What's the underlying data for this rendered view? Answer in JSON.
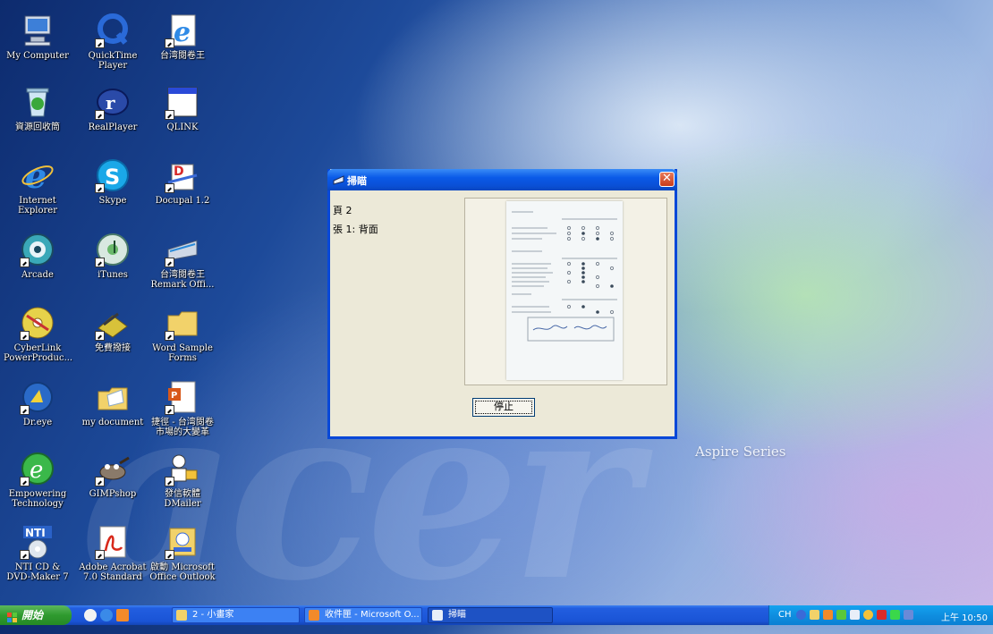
{
  "desktop": {
    "brand_text": "Aspire Series",
    "watermark_text": "acer",
    "icons": [
      {
        "id": "my-computer",
        "label": "My Computer",
        "icon": "computer-icon"
      },
      {
        "id": "quicktime",
        "label": "QuickTime Player",
        "icon": "quicktime-icon"
      },
      {
        "id": "taiwan-reader",
        "label": "台湾閱卷王",
        "icon": "ie-icon"
      },
      {
        "id": "recycle-bin",
        "label": "資源回收筒",
        "icon": "recycle-bin-icon"
      },
      {
        "id": "realplayer",
        "label": "RealPlayer",
        "icon": "realplayer-icon"
      },
      {
        "id": "qlink",
        "label": "QLINK",
        "icon": "window-icon"
      },
      {
        "id": "internet-explorer",
        "label": "Internet Explorer",
        "icon": "ie-icon"
      },
      {
        "id": "skype",
        "label": "Skype",
        "icon": "skype-icon"
      },
      {
        "id": "docupal",
        "label": "Docupal 1.2",
        "icon": "docupal-icon"
      },
      {
        "id": "arcade",
        "label": "Arcade",
        "icon": "arcade-icon"
      },
      {
        "id": "itunes",
        "label": "iTunes",
        "icon": "itunes-icon"
      },
      {
        "id": "remark-office",
        "label": "台湾閱卷王 Remark Offi...",
        "icon": "scanner-icon"
      },
      {
        "id": "cyberlink",
        "label": "CyberLink PowerProduc...",
        "icon": "disc-icon"
      },
      {
        "id": "free-dial",
        "label": "免費撥接",
        "icon": "modem-icon"
      },
      {
        "id": "word-sample-forms",
        "label": "Word Sample Forms",
        "icon": "folder-icon"
      },
      {
        "id": "dreye",
        "label": "Dr.eye",
        "icon": "dreye-icon"
      },
      {
        "id": "my-document",
        "label": "my document",
        "icon": "folder-open-icon"
      },
      {
        "id": "taiwan-shortcut",
        "label": "捷徑 - 台湾閱卷 市場的大變革",
        "icon": "powerpoint-icon"
      },
      {
        "id": "empowering",
        "label": "Empowering Technology",
        "icon": "empowering-icon"
      },
      {
        "id": "gimpshop",
        "label": "GIMPshop",
        "icon": "gimp-icon"
      },
      {
        "id": "dmailer",
        "label": "發信軟體 DMailer",
        "icon": "dmailer-icon"
      },
      {
        "id": "nti-cd",
        "label": "NTI CD & DVD-Maker 7",
        "icon": "nti-icon"
      },
      {
        "id": "adobe-acrobat",
        "label": "Adobe Acrobat 7.0 Standard",
        "icon": "acrobat-icon"
      },
      {
        "id": "outlook",
        "label": "啟動 Microsoft Office Outlook",
        "icon": "outlook-icon"
      }
    ]
  },
  "dialog": {
    "title": "掃瞄",
    "page_text": "頁 2",
    "sheet_text": "張 1: 背面",
    "stop_label": "停止",
    "close_glyph": "✕"
  },
  "taskbar": {
    "start_label": "開始",
    "tasks": [
      {
        "label": "2 - 小畫家"
      },
      {
        "label": "收件匣 - Microsoft O..."
      },
      {
        "label": "掃瞄"
      }
    ],
    "tray": {
      "lang": "CH",
      "clock": "上午 10:50"
    }
  },
  "colors": {
    "titlebar_blue": "#0a5ae8",
    "start_green": "#2f9a2f",
    "tray_blue": "#0f8ee0",
    "dialog_face": "#ece9d8"
  }
}
